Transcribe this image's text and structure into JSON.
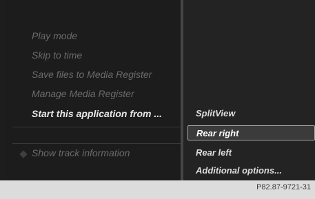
{
  "left_menu": {
    "items": [
      {
        "label": "Play mode"
      },
      {
        "label": "Skip to time"
      },
      {
        "label": "Save files to Media Register"
      },
      {
        "label": "Manage Media Register"
      },
      {
        "label": "Start this application from ..."
      },
      {
        "label": "Show track information"
      }
    ]
  },
  "submenu": {
    "items": [
      {
        "label": "SplitView"
      },
      {
        "label": "Rear right"
      },
      {
        "label": "Rear left"
      },
      {
        "label": "Additional options..."
      }
    ]
  },
  "caption": "P82.87-9721-31"
}
